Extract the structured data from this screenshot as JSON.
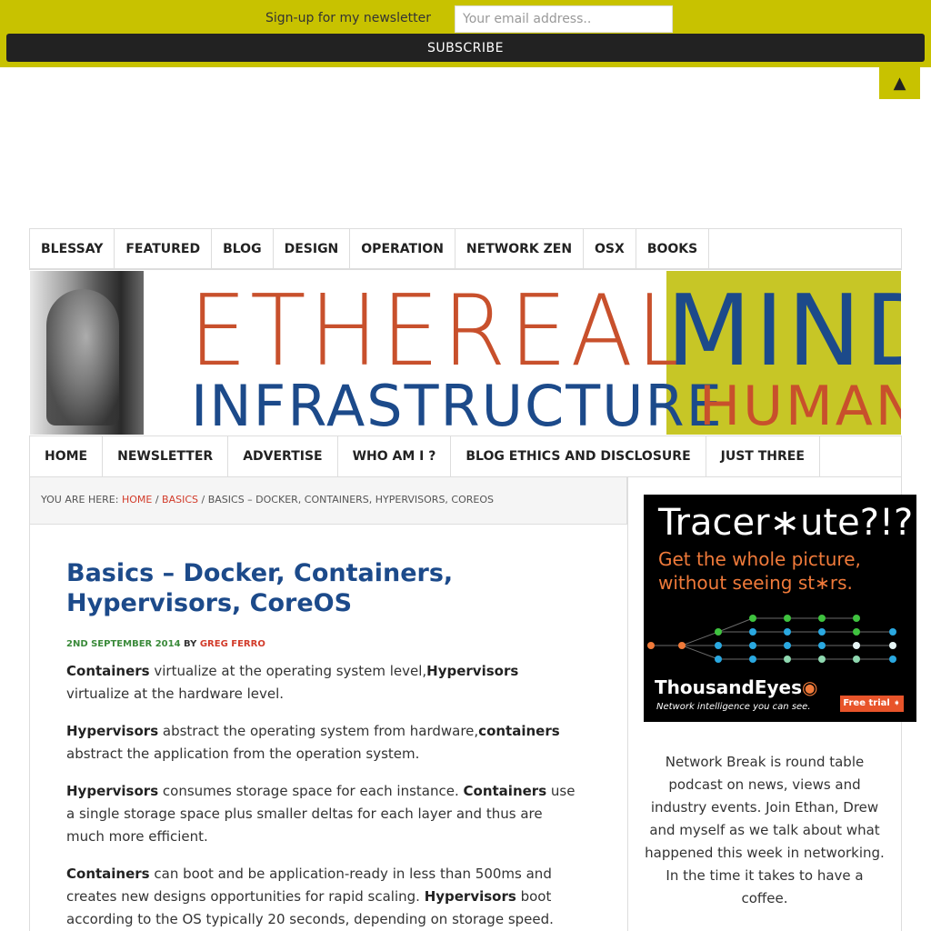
{
  "newsletter": {
    "label": "Sign-up for my newsletter",
    "email_placeholder": "Your email address..",
    "subscribe_label": "SUBSCRIBE"
  },
  "back_to_top": "▲",
  "top_nav": {
    "items": [
      "BLESSAY",
      "FEATURED",
      "BLOG",
      "DESIGN",
      "OPERATION",
      "NETWORK ZEN",
      "OSX",
      "BOOKS"
    ]
  },
  "banner": {
    "line1_left": "ETHEREAL",
    "line1_right": "MIND",
    "line2_left": "INFRASTRUCTURE",
    "line2_right": "HUMAN"
  },
  "sub_nav": {
    "items": [
      "HOME",
      "NEWSLETTER",
      "ADVERTISE",
      "WHO AM I ?",
      "BLOG ETHICS AND DISCLOSURE",
      "JUST THREE"
    ]
  },
  "breadcrumb": {
    "prefix": "YOU ARE HERE:",
    "home": "HOME",
    "sep1": " / ",
    "category": "BASICS",
    "sep2": " / ",
    "current": "BASICS – DOCKER, CONTAINERS, HYPERVISORS, COREOS"
  },
  "post": {
    "title": "Basics – Docker, Containers, Hypervisors, CoreOS",
    "date": "2ND SEPTEMBER 2014",
    "by": " BY ",
    "author": "GREG FERRO",
    "paragraphs": [
      {
        "b1": "Containers",
        "t1": " virtualize at the operating system level,",
        "b2": "Hypervisors",
        "t2": " virtualize at the hardware level."
      },
      {
        "b1": "Hypervisors",
        "t1": " abstract the operating system from hardware,",
        "b2": "containers",
        "t2": " abstract the application from the operation system."
      },
      {
        "b1": "Hypervisors",
        "t1": " consumes storage space for each instance. ",
        "b2": "Containers",
        "t2": " use a single storage space plus smaller deltas for each layer and thus are much more efficient."
      },
      {
        "b1": "Containers",
        "t1": " can boot and be application-ready in less than 500ms and creates new designs opportunities for rapid scaling. ",
        "b2": "Hypervisors",
        "t2": " boot according to the OS typically 20 seconds, depending on storage speed."
      }
    ]
  },
  "ad": {
    "title": "Tracer∗ute?!?",
    "line1": "Get the whole picture,",
    "line2": "without seeing st∗rs.",
    "brand_main": "ThousandEyes",
    "brand_mark": "◉",
    "tagline": "Network intelligence you can see.",
    "cta": "Free trial ➧"
  },
  "sidebar": {
    "text": "Network Break is round table podcast on news, views and industry events. Join Ethan, Drew and myself as we talk about what happened this week in networking. In the time it takes to have a coffee."
  },
  "colors": {
    "accent_yellow": "#c8c200",
    "title_blue": "#1c4a8a",
    "link_red": "#d23b2a",
    "date_green": "#3a8a3a"
  }
}
